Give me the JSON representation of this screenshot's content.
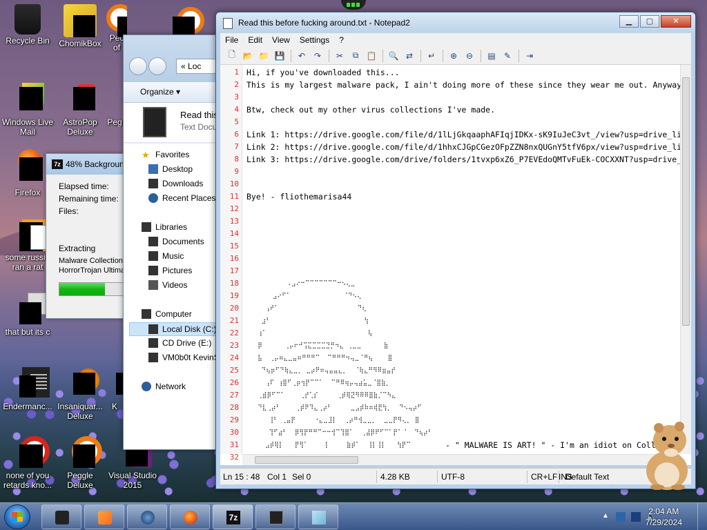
{
  "desktop": {
    "icons": [
      {
        "label": "Recycle Bin"
      },
      {
        "label": "ChomikBox"
      },
      {
        "label": "Pec of"
      },
      {
        "label": "Windows Live Mail"
      },
      {
        "label": "AstroPop Deluxe"
      },
      {
        "label": "Peg"
      },
      {
        "label": "Firefox"
      },
      {
        "label": "some russia ran a rat"
      },
      {
        "label": "that but its c"
      },
      {
        "label": "Endermanc..."
      },
      {
        "label": "Insaniquar... Deluxe"
      },
      {
        "label": "K"
      },
      {
        "label": "none of you retards kno..."
      },
      {
        "label": "Peggle Deluxe"
      },
      {
        "label": "Visual Studio 2015"
      }
    ]
  },
  "sevenzip": {
    "title": "48% Backgroun",
    "logo": "7z",
    "elapsed_label": "Elapsed time:",
    "remaining_label": "Remaining time:",
    "files_label": "Files:",
    "extracting_label": "Extracting",
    "file1": "Malware Collection\\",
    "file2": "HorrorTrojan Ultimat",
    "progress_percent": 48
  },
  "explorer": {
    "address_prefix": "«",
    "address": "Loc",
    "organize": "Organize ▾",
    "preview_name": "Read this",
    "preview_type": "Text Docu",
    "tree": [
      {
        "label": "Favorites"
      },
      {
        "label": "Desktop"
      },
      {
        "label": "Downloads"
      },
      {
        "label": "Recent Places"
      },
      {
        "label": "Libraries"
      },
      {
        "label": "Documents"
      },
      {
        "label": "Music"
      },
      {
        "label": "Pictures"
      },
      {
        "label": "Videos"
      },
      {
        "label": "Computer"
      },
      {
        "label": "Local Disk (C:)"
      },
      {
        "label": "CD Drive (E:)"
      },
      {
        "label": "VM0b0t KevinS"
      },
      {
        "label": "Network"
      }
    ]
  },
  "notepad": {
    "title": "Read this before fucking around.txt - Notepad2",
    "menu": [
      "File",
      "Edit",
      "View",
      "Settings",
      "?"
    ],
    "lines": [
      {
        "n": "1",
        "text": "Hi, if you've downloaded this..."
      },
      {
        "n": "2",
        "text": "This is my largest malware pack, I ain't doing more of these since they wear me out. Anyway"
      },
      {
        "n": "3",
        "text": ""
      },
      {
        "n": "4",
        "text": "Btw, check out my other virus collections I've made."
      },
      {
        "n": "5",
        "text": ""
      },
      {
        "n": "6",
        "text": "Link 1: https://drive.google.com/file/d/1lLjGkqaaphAFIqjIDKx-sK9IuJeC3vt_/view?usp=drive_li"
      },
      {
        "n": "7",
        "text": "Link 2: https://drive.google.com/file/d/1hhxCJGpCGezOFpZZN8nxQUGnY5tfV6px/view?usp=drive_li"
      },
      {
        "n": "8",
        "text": "Link 3: https://drive.google.com/drive/folders/1tvxp6xZ6_P7EVEdoQMTvFuEk-COCXXNT?usp=drive_"
      },
      {
        "n": "9",
        "text": ""
      },
      {
        "n": "10",
        "text": ""
      },
      {
        "n": "11",
        "text": "Bye! - fliothemarisa44"
      },
      {
        "n": "12",
        "text": ""
      },
      {
        "n": "13",
        "text": ""
      },
      {
        "n": "14",
        "text": ""
      },
      {
        "n": "15",
        "text": ""
      },
      {
        "n": "16",
        "text": ""
      },
      {
        "n": "17",
        "text": ""
      },
      {
        "n": "18",
        "text": "           .⣠⠔⠒⠉⠉⠉⠉⠉⠉⠉⠒⠢⢄⣀"
      },
      {
        "n": "19",
        "text": "       ⣠⠔⠋⠁              ⠈⠙⠢⢄"
      },
      {
        "n": "20",
        "text": "     ⢠⠞⠁                     ⠙⢆"
      },
      {
        "n": "21",
        "text": "    ⣰⠃                         ⢳"
      },
      {
        "n": "22",
        "text": "   ⢰⠁                           ⢧"
      },
      {
        "n": "23",
        "text": "   ⡿      ⢀⡤⠖⠚⢩⣍⣉⣉⣉⣙⡛⠲⣄ ⢀⣀⣀      ⣷"
      },
      {
        "n": "24",
        "text": "   ⣧  ⢀⡤⠶⣄⣀⣤⠶⠛⠛⠛⠉  ⠉⠛⠛⠛⠲⢤⣀⠈⠛⢦    ⣿"
      },
      {
        "n": "25",
        "text": "    ⠙⢦⡶⠋⠙⢷⣄⣀⡀ ⣀⡴⠟⠶⢤⣤⣤⣄⡀  ⠈⢷⣄⠛⠻⠿⣶⣤⡞"
      },
      {
        "n": "26",
        "text": "     ⢠⠏ ⢰⣿⠋⢀⡶⢲⡟⠉⠉⠁  ⠉⠛⠿⢶⡤⢤⣴⣥⣀⠈⣿⣷⡀"
      },
      {
        "n": "27",
        "text": "   ⢀⣾⡿⠋⠉⠁    ⢀⡞⢁⡎     ⢀⡾⢿⣝⠻⠿⠿⣿⣷⡈⠉⠳⣄"
      },
      {
        "n": "28",
        "text": "   ⠙⣇⢀⡴⠃    ⢀⡾⠟⠹⣄⢀⡴⠃     ⣀⣠⡾⠷⠶⢾⣟⢳⡀  ⠙⠢⢤⡴⠋"
      },
      {
        "n": "29",
        "text": "      ⢸⠃ ⢀⣤⡟     ⠐⣄⣀⣸⡇  ⢀⡴⠛⢺⣀⣀⡀  ⣀⣀⡟⠻⢄⡀ ⣿"
      },
      {
        "n": "30",
        "text": "      ⢹⠋⣴⠃  ⡿⢻⡟⠛⠛⠉⠒⠒⢺⠉⢹⣿⠁  ⢀⣼⡿⠟⠋⠉⠁⡟⠁⠈  ⠙⢦⡴⠃"
      },
      {
        "n": "31",
        "text": "     ⣠⡾⢿⡇   ⡟⢻⠁    ⢸     ⣷⡾⠁  ⢸⡇⢸⡇   ⢳⡟⠉"
      },
      {
        "n": "32",
        "text": "       ⣿    ⢸⡇ ⢸⠇        ⢧     ⣸⡇⢀⣾"
      }
    ],
    "art_caption": "- \" MALWARE IS ART! \" - I'm an idiot on Coll",
    "status": {
      "position": "Ln 15 : 48",
      "col": "Col 1",
      "sel": "Sel 0",
      "size": "4.28 KB",
      "encoding": "UTF-8",
      "eol": "CR+LF",
      "ins": "INS",
      "scheme": "Default Text"
    }
  },
  "taskbar": {
    "clock_time": "2:04 AM",
    "clock_date": "7/29/2024"
  },
  "colors": {
    "line_number": "#e03030",
    "progress_green": "#14b614",
    "selection": "#cce4f7"
  }
}
